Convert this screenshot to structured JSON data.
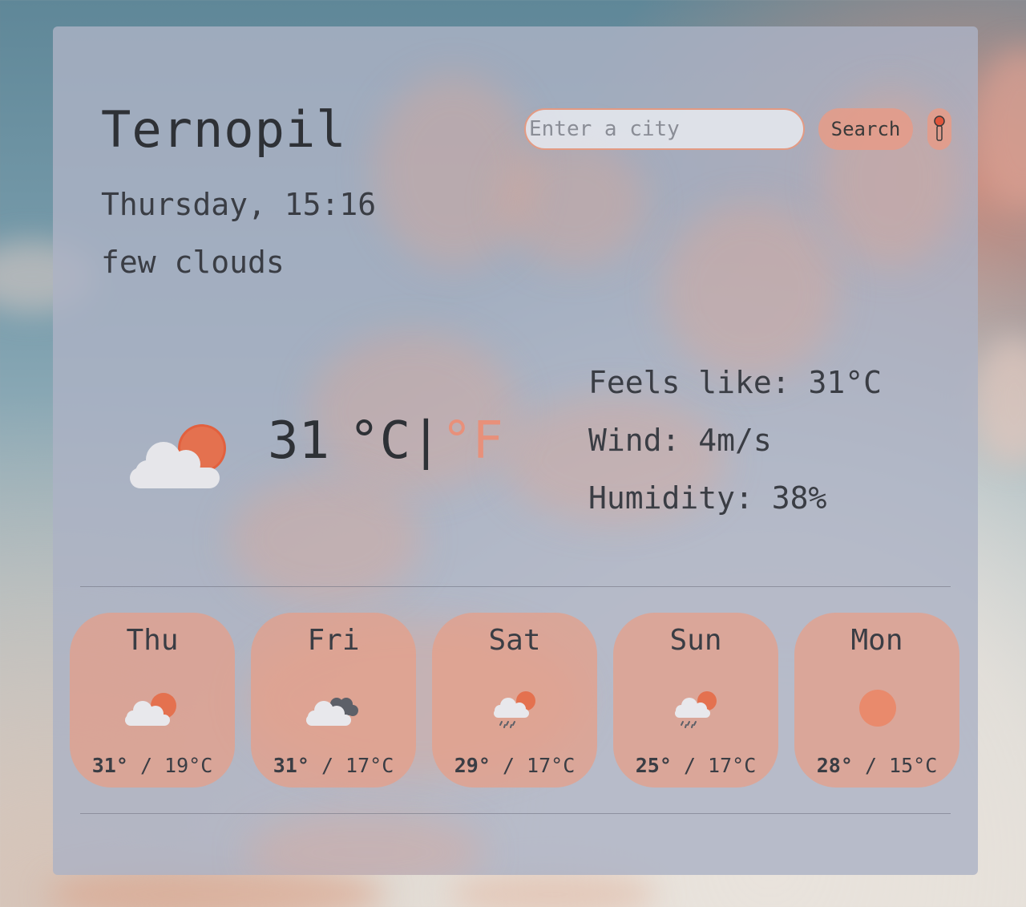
{
  "weather": {
    "city": "Ternopil",
    "datetime": "Thursday, 15:16",
    "description": "few clouds",
    "temperature": "31",
    "unit_c": "°C",
    "unit_separator": "|",
    "unit_f": "°F",
    "main_icon": "cloud-sun-icon",
    "details": {
      "feels_like": "Feels like: 31°C",
      "wind": "Wind: 4m/s",
      "humidity": "Humidity: 38%"
    }
  },
  "search": {
    "placeholder": "Enter a city",
    "value": "",
    "button_label": "Search",
    "location_icon": "location-pin-icon"
  },
  "forecast": [
    {
      "day": "Thu",
      "max": "31°",
      "separator": " / ",
      "min": "19°C",
      "icon": "cloud-sun-icon"
    },
    {
      "day": "Fri",
      "max": "31°",
      "separator": " / ",
      "min": "17°C",
      "icon": "cloud-dark-cloud-icon"
    },
    {
      "day": "Sat",
      "max": "29°",
      "separator": " / ",
      "min": "17°C",
      "icon": "rain-sun-icon"
    },
    {
      "day": "Sun",
      "max": "25°",
      "separator": " / ",
      "min": "17°C",
      "icon": "rain-sun-icon"
    },
    {
      "day": "Mon",
      "max": "28°",
      "separator": " / ",
      "min": "15°C",
      "icon": "sun-icon"
    }
  ],
  "colors": {
    "accent": "#e8907a",
    "panel": "#acb2c4",
    "text": "#2e3136"
  }
}
